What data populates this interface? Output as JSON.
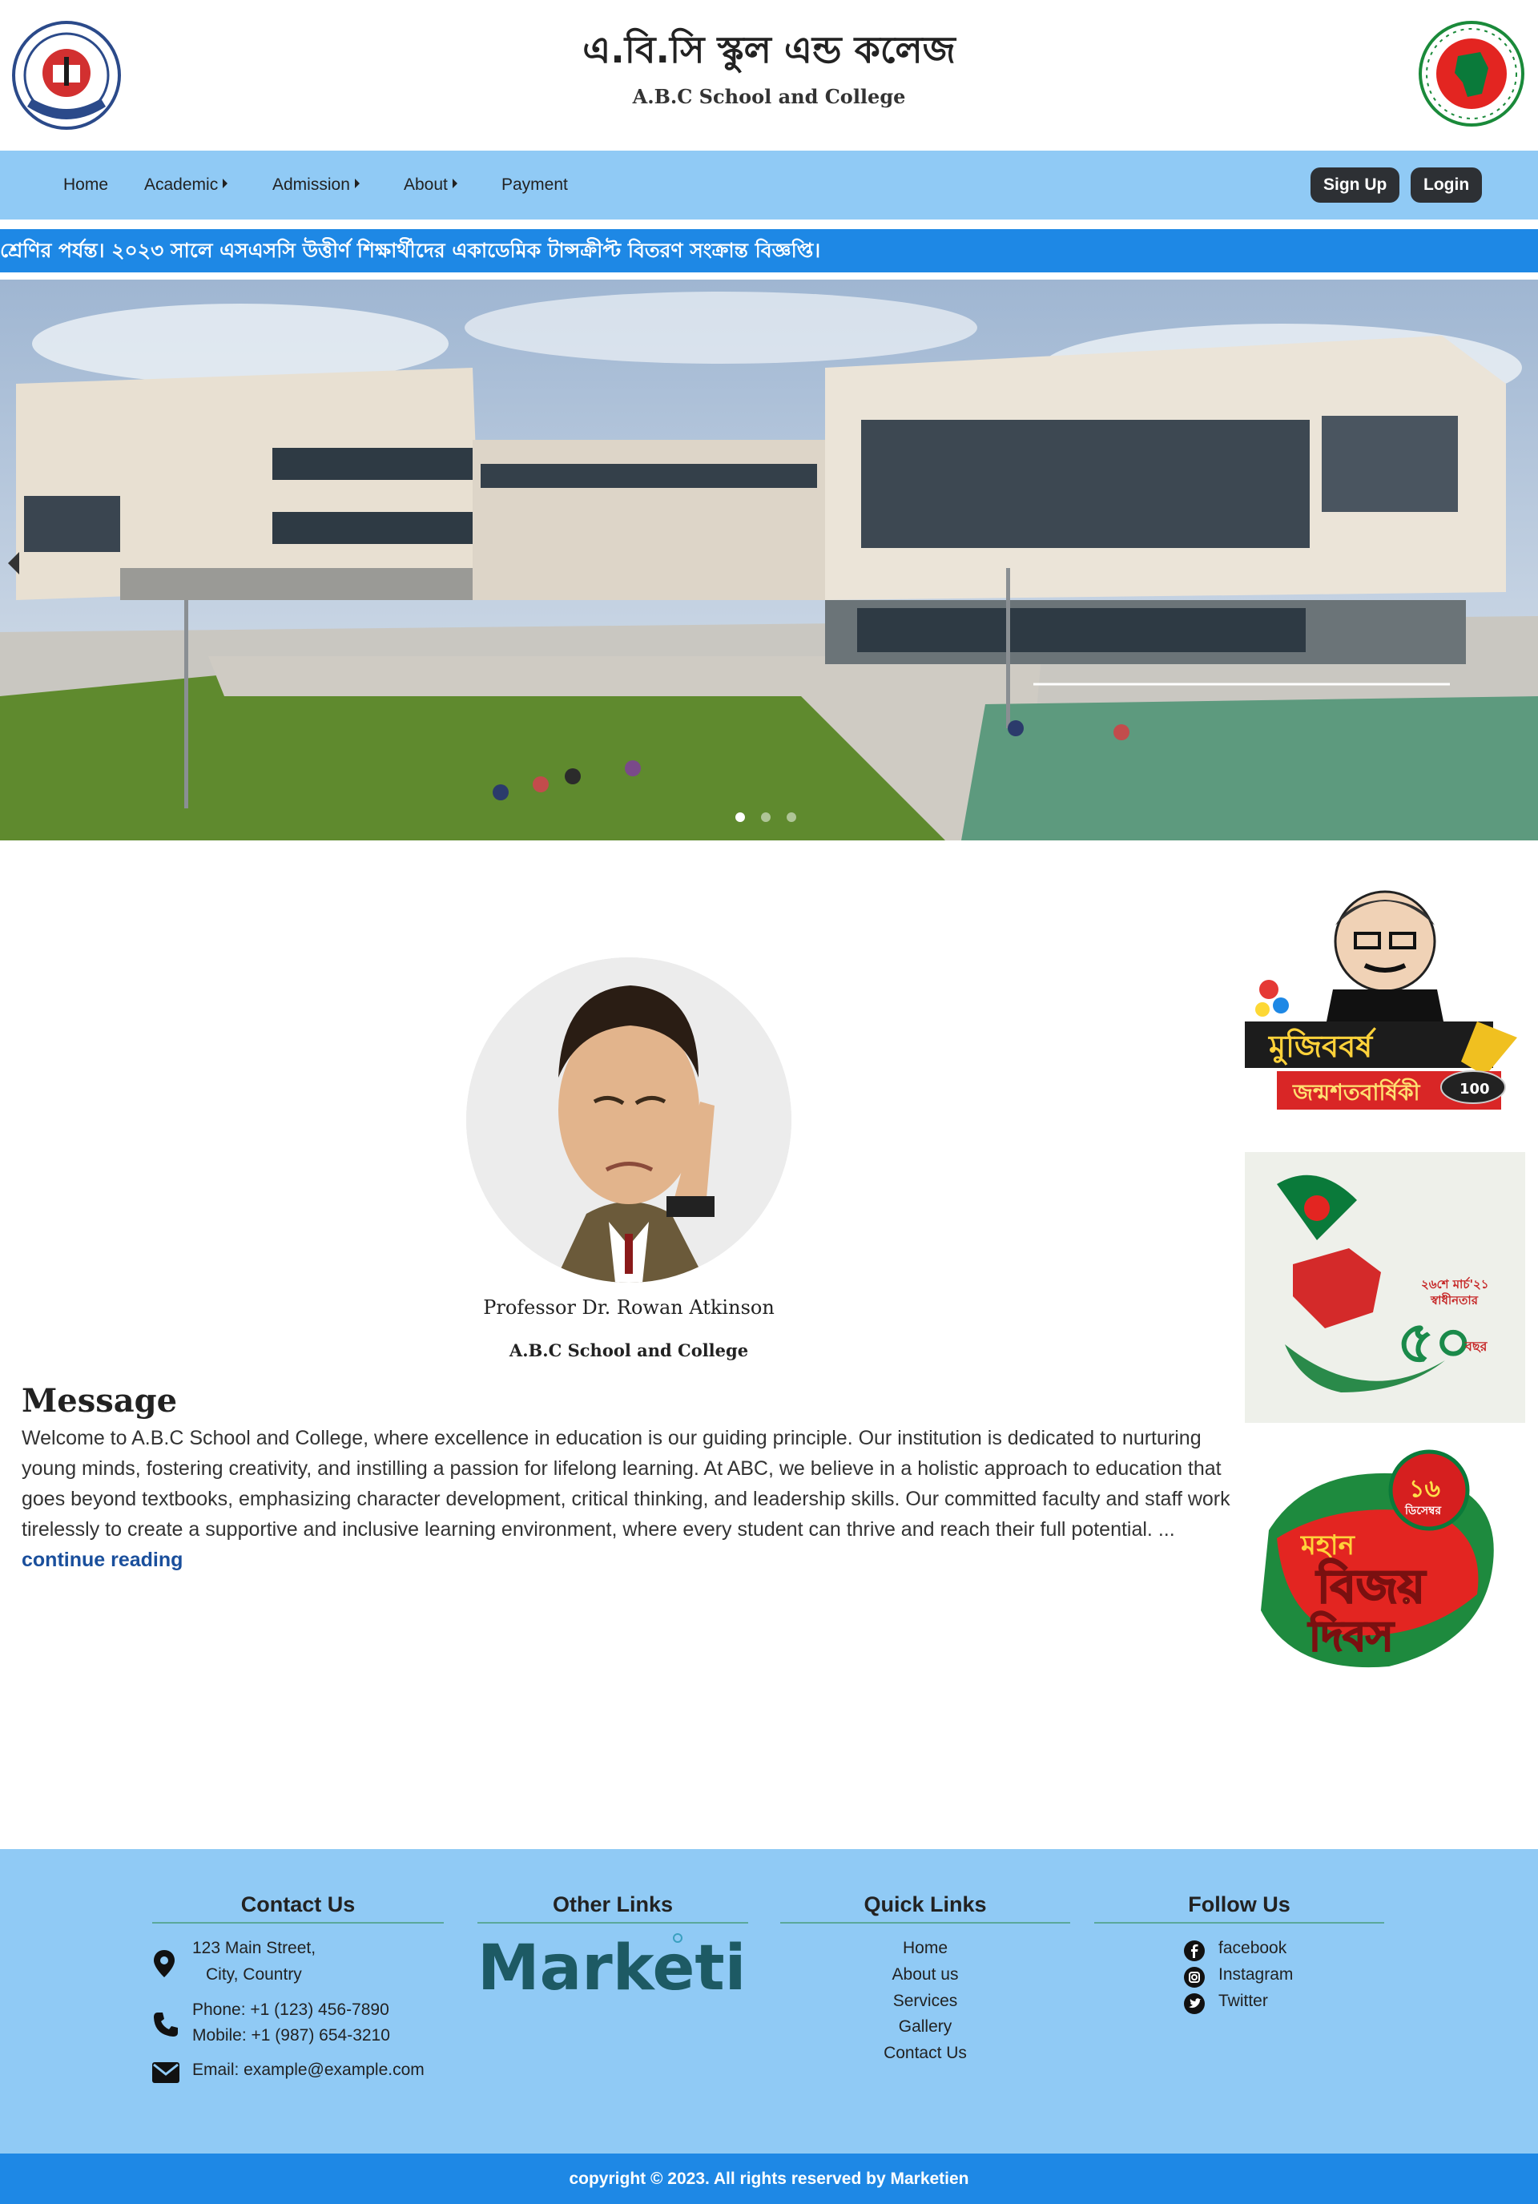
{
  "header": {
    "title_bn": "এ.বি.সি স্কুল এন্ড কলেজ",
    "title_en": "A.B.C School and College"
  },
  "nav": {
    "items": [
      {
        "label": "Home"
      },
      {
        "label": "Academic"
      },
      {
        "label": "Admission"
      },
      {
        "label": "About"
      },
      {
        "label": "Payment"
      }
    ],
    "signup_label": "Sign Up",
    "login_label": "Login"
  },
  "ticker": {
    "text": "শ্রেণির পর্যন্ত। ২০২৩ সালে এসএসসি উত্তীর্ণ শিক্ষার্থীদের একাডেমিক টান্সক্রীপ্ট বিতরণ সংক্রান্ত বিজ্ঞপ্তি।"
  },
  "hero": {
    "slide_count": 3,
    "active_slide": 1
  },
  "message": {
    "professor_name": "Professor Dr. Rowan Atkinson",
    "school": "A.B.C School and College",
    "title": "Message",
    "body": "Welcome to A.B.C School and College, where excellence in education is our guiding principle. Our institution is dedicated to nurturing young minds, fostering creativity, and instilling a passion for lifelong learning. At ABC, we believe in a holistic approach to education that goes beyond textbooks, emphasizing character development, critical thinking, and leadership skills. Our committed faculty and staff work tirelessly to create a supportive and inclusive learning environment, where every student can thrive and reach their full potential. ...",
    "link": "continue reading"
  },
  "banners": {
    "b1_title": "মুজিববর্ষ",
    "b1_sub": "জন্মশতবার্ষিকী",
    "b1_badge": "100",
    "b2_num": "৫০",
    "b2_sub": "বছর",
    "b2_date": "২৬শে মার্চ'২১",
    "b2_caption": "স্বাধীনতার",
    "b3_date": "১৬",
    "b3_month": "ডিসেম্বর",
    "b3_title_1": "মহান",
    "b3_title_2": "বিজয়",
    "b3_title_3": "দিবস"
  },
  "footer": {
    "contact_title": "Contact Us",
    "address_line1": "123 Main Street,",
    "address_line2": "City, Country",
    "phone": "Phone: +1 (123) 456-7890",
    "mobile": "Mobile: +1 (987) 654-3210",
    "email": "Email: example@example.com",
    "other_title": "Other Links",
    "marketien_logo": "Marketien",
    "quick_title": "Quick Links",
    "quick_links": [
      "Home",
      "About us",
      "Services",
      "Gallery",
      "Contact Us"
    ],
    "follow_title": "Follow Us",
    "social": [
      "facebook",
      "Instagram",
      "Twitter"
    ],
    "copyright": "copyright © 2023. All rights reserved by Marketien"
  },
  "colors": {
    "nav_bg": "#90caf5",
    "ticker_bg": "#1e88e5",
    "button_bg": "#2d3034",
    "link": "#1a4f9c"
  },
  "icons": [
    "school-logo-icon",
    "government-seal-icon",
    "map-pin-icon",
    "phone-icon",
    "mail-icon",
    "facebook-icon",
    "instagram-icon",
    "twitter-icon"
  ]
}
